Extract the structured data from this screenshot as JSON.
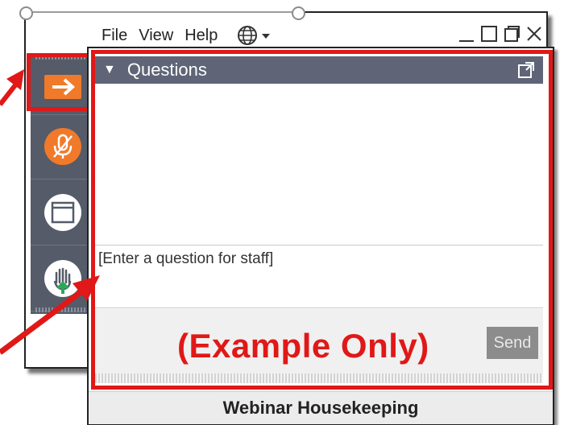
{
  "menu": {
    "file": "File",
    "view": "View",
    "help": "Help"
  },
  "icons": {
    "globe": "globe-icon",
    "minimize": "minimize-icon",
    "maximize": "maximize-icon",
    "restore": "restore-icon",
    "close": "close-icon",
    "arrow": "arrow-right-icon",
    "mic": "microphone-muted-icon",
    "window": "window-icon",
    "hand": "raise-hand-icon",
    "popout": "popout-icon"
  },
  "panel": {
    "title": "Questions",
    "input_placeholder": "[Enter a question for staff]",
    "send_label": "Send",
    "annotation": "(Example Only)",
    "footer": "Webinar Housekeeping"
  },
  "colors": {
    "highlight": "#e01818",
    "toolbar": "#555b68",
    "panel_header": "#5f6577",
    "accent_orange": "#f07a2a",
    "hand_green": "#2aa85a"
  }
}
